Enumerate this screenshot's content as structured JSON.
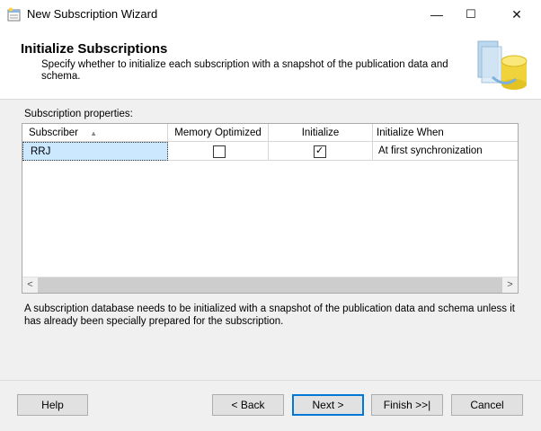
{
  "window": {
    "title": "New Subscription Wizard",
    "min": "—",
    "max": "☐",
    "close": "✕"
  },
  "header": {
    "title": "Initialize Subscriptions",
    "subtitle": "Specify whether to initialize each subscription with a snapshot of the publication data and schema."
  },
  "grid": {
    "label": "Subscription properties:",
    "columns": [
      "Subscriber",
      "Memory Optimized",
      "Initialize",
      "Initialize When"
    ],
    "rows": [
      {
        "subscriber": "RRJ",
        "memory_optimized": false,
        "initialize": true,
        "initialize_when": "At first synchronization"
      }
    ],
    "sort_glyph": "▲",
    "scroll_left": "<",
    "scroll_right": ">"
  },
  "info_text": "A subscription database needs to be initialized with a snapshot of the publication data and schema unless it has already been specially prepared for the subscription.",
  "buttons": {
    "help": "Help",
    "back": "< Back",
    "next": "Next >",
    "finish": "Finish >>|",
    "cancel": "Cancel"
  },
  "icons": {
    "check": "✓"
  }
}
